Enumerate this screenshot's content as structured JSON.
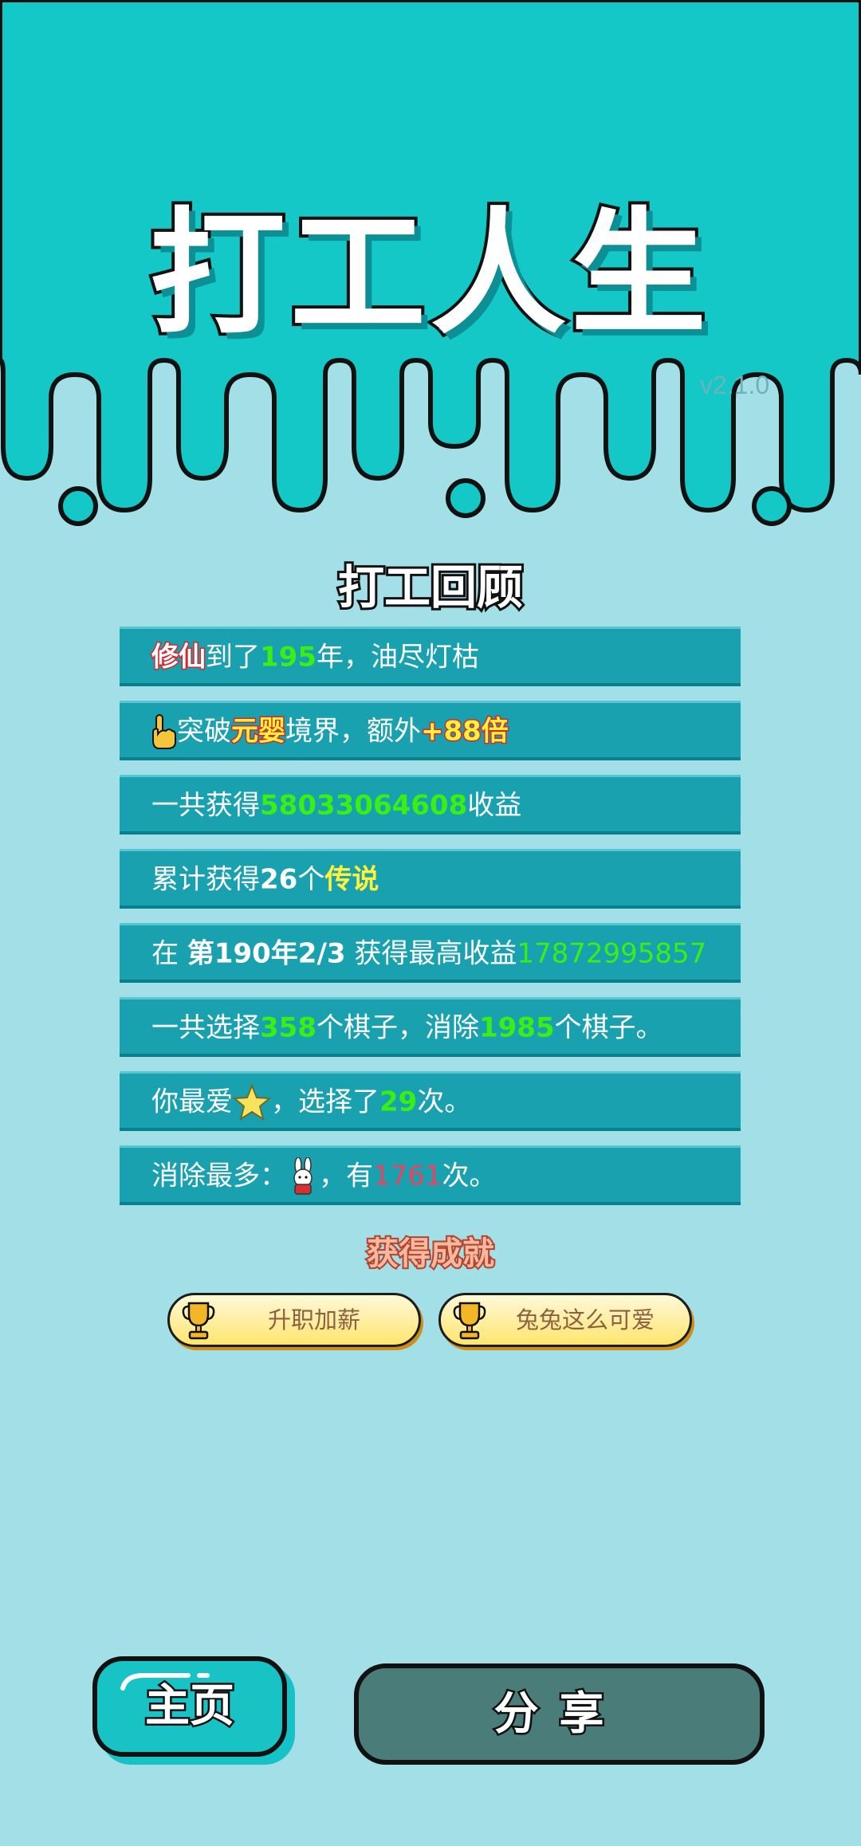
{
  "header": {
    "title": "打工人生",
    "version": "v2.1.0"
  },
  "review": {
    "title": "打工回顾",
    "rows": [
      {
        "tag": "修仙",
        "t1": "到了",
        "num": "195",
        "t2": "年，油尽灯枯"
      },
      {
        "t1": "突破",
        "tag": "元婴",
        "t2": "境界，额外",
        "bonus": "+88倍"
      },
      {
        "t1": "一共获得",
        "num": "58033064608",
        "t2": "收益"
      },
      {
        "t1": "累计获得",
        "num": "26",
        "t2": "个",
        "tag": "传说"
      },
      {
        "t1": "在 ",
        "bold": "第190年2/3",
        "t2": " 获得最高收益",
        "num": "17872995857"
      },
      {
        "t1": "一共选择",
        "num": "358",
        "t2": "个棋子，消除",
        "num2": "1985",
        "t3": "个棋子。"
      },
      {
        "t1": "你最爱",
        "t2": "，选择了",
        "num": "29",
        "t3": "次。"
      },
      {
        "t1": "消除最多：",
        "t2": "，有",
        "num": "1761",
        "t3": "次。"
      }
    ]
  },
  "achievements": {
    "title": "获得成就",
    "items": [
      "升职加薪",
      "兔兔这么可爱"
    ]
  },
  "buttons": {
    "home": "主页",
    "share": "分享"
  },
  "colors": {
    "top_bg": "#14c8c8",
    "page_bg": "#a2dfe6",
    "row_bg": "#1aa1b0",
    "highlight": "#39f012"
  }
}
